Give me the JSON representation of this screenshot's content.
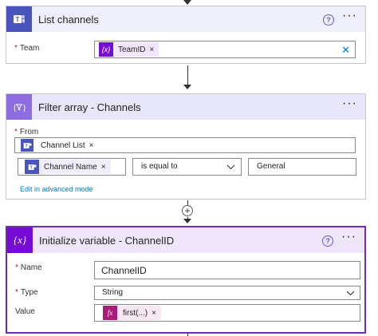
{
  "connectors": {
    "insert_step_symbol": "+"
  },
  "card1": {
    "title": "List channels",
    "help_symbol": "?",
    "more_symbol": "···",
    "team": {
      "label": "Team",
      "required_mark": "*",
      "token_label": "TeamID",
      "token_icon_text": "{x}",
      "clear_symbol": "✕"
    }
  },
  "card2": {
    "title": "Filter array - Channels",
    "more_symbol": "···",
    "from": {
      "label": "From",
      "required_mark": "*",
      "token_label": "Channel List"
    },
    "condition": {
      "left_token_label": "Channel Name",
      "operator_value": "is equal to",
      "right_value": "General"
    },
    "advanced_link": "Edit in advanced mode",
    "remove_symbol": "×"
  },
  "card3": {
    "title": "Initialize variable - ChannelID",
    "help_symbol": "?",
    "more_symbol": "···",
    "name": {
      "label": "Name",
      "required_mark": "*",
      "value": "ChannelID"
    },
    "type": {
      "label": "Type",
      "required_mark": "*",
      "value": "String"
    },
    "value": {
      "label": "Value",
      "token_label": "first(...)",
      "token_icon_text": "fx"
    }
  },
  "colors": {
    "teams_purple": "#4b53bc",
    "variable_purple": "#770bd6",
    "filter_header": "#e8e6fa",
    "variable_header": "#f0e6fb",
    "link_blue": "#0078d4",
    "selected_border": "#6b2fb3"
  }
}
